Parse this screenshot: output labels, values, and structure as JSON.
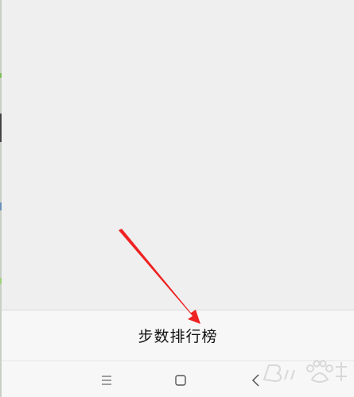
{
  "menu": {
    "step_ranking_label": "步数排行榜"
  },
  "nav": {
    "menu_icon": "hamburger-icon",
    "home_icon": "square-icon",
    "back_icon": "chevron-left-icon"
  },
  "colors": {
    "background": "#efefef",
    "panel": "#f7f7f7",
    "annotation_arrow": "#ee2222",
    "text": "#111111"
  }
}
